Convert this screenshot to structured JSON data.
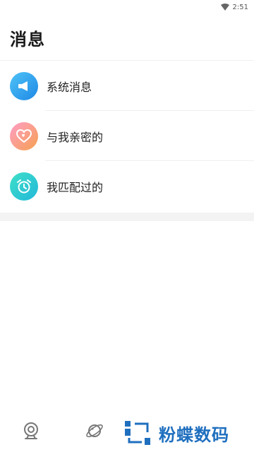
{
  "status_bar": {
    "time": "2:51"
  },
  "page": {
    "title": "消息"
  },
  "messages": {
    "items": [
      {
        "label": "系统消息",
        "icon": "megaphone-icon"
      },
      {
        "label": "与我亲密的",
        "icon": "heart-icon"
      },
      {
        "label": "我匹配过的",
        "icon": "alarm-clock-icon"
      }
    ]
  },
  "bottom_nav": {
    "items": [
      {
        "icon": "camera-icon"
      },
      {
        "icon": "planet-icon"
      }
    ]
  },
  "watermark": {
    "text": "粉蝶数码"
  }
}
